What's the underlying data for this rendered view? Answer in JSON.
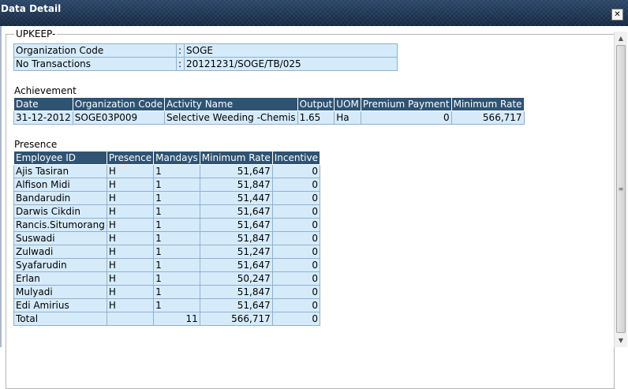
{
  "window": {
    "title": "Data Detail",
    "close_glyph": "✕"
  },
  "section_title": "UPKEEP-",
  "info": [
    {
      "label": "Organization Code",
      "sep": ":",
      "value": "SOGE"
    },
    {
      "label": "No Transactions",
      "sep": ":",
      "value": "20121231/SOGE/TB/025"
    }
  ],
  "achievement": {
    "heading": "Achievement",
    "columns": [
      "Date",
      "Organization Code",
      "Activity Name",
      "Output",
      "UOM",
      "Premium Payment",
      "Minimum Rate"
    ],
    "rows": [
      [
        "31-12-2012",
        "SOGE03P009",
        "Selective Weeding -Chemis",
        "1.65",
        "Ha",
        "0",
        "566,717"
      ]
    ]
  },
  "presence": {
    "heading": "Presence",
    "columns": [
      "Employee ID",
      "Presence",
      "Mandays",
      "Minimum Rate",
      "Incentive"
    ],
    "rows": [
      [
        "Ajis Tasiran",
        "H",
        "1",
        "51,647",
        "0"
      ],
      [
        "Alfison Midi",
        "H",
        "1",
        "51,847",
        "0"
      ],
      [
        "Bandarudin",
        "H",
        "1",
        "51,447",
        "0"
      ],
      [
        "Darwis Cikdin",
        "H",
        "1",
        "51,647",
        "0"
      ],
      [
        "Rancis.Situmorang",
        "H",
        "1",
        "51,647",
        "0"
      ],
      [
        "Suswadi",
        "H",
        "1",
        "51,847",
        "0"
      ],
      [
        "Zulwadi",
        "H",
        "1",
        "51,247",
        "0"
      ],
      [
        "Syafarudin",
        "H",
        "1",
        "51,647",
        "0"
      ],
      [
        "Erlan",
        "H",
        "1",
        "50,247",
        "0"
      ],
      [
        "Mulyadi",
        "H",
        "1",
        "51,847",
        "0"
      ],
      [
        "Edi Amirius",
        "H",
        "1",
        "51,647",
        "0"
      ]
    ],
    "total": [
      "Total",
      "",
      "11",
      "566,717",
      "0"
    ]
  },
  "colors": {
    "header_bg": "#2e5373",
    "cell_bg": "#d6ebfa",
    "titlebar_bg": "#1e3450"
  }
}
